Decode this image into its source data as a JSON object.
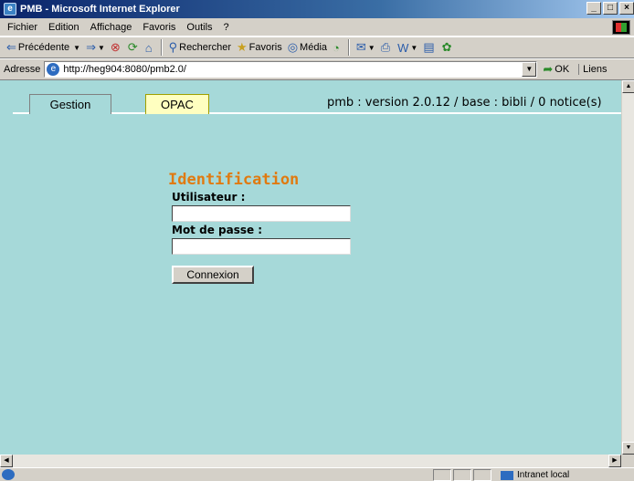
{
  "window": {
    "title": "PMB - Microsoft Internet Explorer",
    "btn_min": "_",
    "btn_max": "□",
    "btn_close": "×"
  },
  "menu": [
    "Fichier",
    "Edition",
    "Affichage",
    "Favoris",
    "Outils",
    "?"
  ],
  "toolbar": {
    "back": "Précédente",
    "search": "Rechercher",
    "favorites": "Favoris",
    "media": "Média"
  },
  "address": {
    "label": "Adresse",
    "url": "http://heg904:8080/pmb2.0/",
    "go": "OK",
    "links": "Liens"
  },
  "page": {
    "tabs": [
      "Gestion",
      "OPAC"
    ],
    "version_info": "pmb : version 2.0.12 / base : bibli / 0 notice(s)",
    "login": {
      "title": "Identification",
      "user_label": "Utilisateur :",
      "user_value": "",
      "password_label": "Mot de passe :",
      "password_value": "",
      "submit": "Connexion"
    }
  },
  "status": {
    "zone": "Intranet local"
  }
}
